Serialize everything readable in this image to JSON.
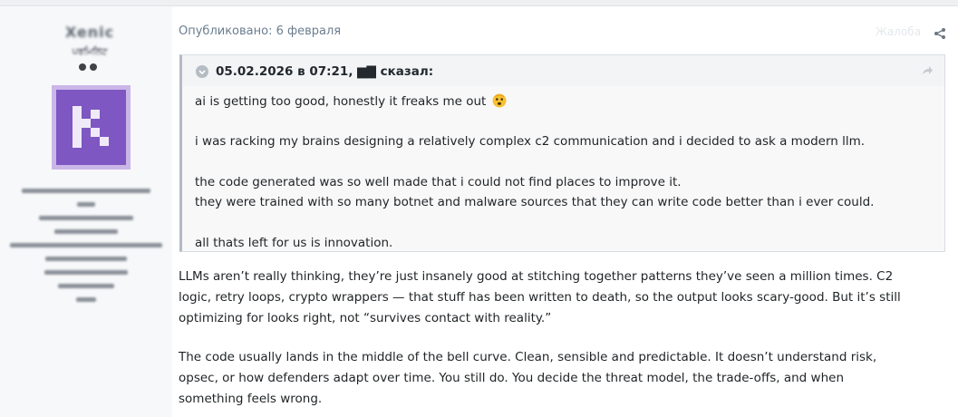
{
  "author": {
    "username": "Xenic",
    "title": "ਪਰਮਿਲਿਟ",
    "avatar_color": "#7e57c2"
  },
  "post": {
    "published": "Опубликовано: 6 февраля",
    "report_label": "Жалоба"
  },
  "quote": {
    "attribution": "05.02.2026 в 07:21, ▆▇ сказал:",
    "lines": [
      "ai is getting too good, honestly it freaks me out",
      "i was racking my brains designing a relatively complex c2 communication and i decided to ask a modern llm.",
      "the code generated was so well made that i could not find places to improve it.",
      "they were trained with so many botnet and malware sources that they can write code better than i ever could.",
      "all thats left for us is innovation."
    ],
    "emoji": "scared-face-emoji"
  },
  "reply": {
    "lines": [
      "LLMs aren’t really thinking, they’re just insanely good at stitching together patterns they’ve seen a million times. C2",
      "logic, retry loops, crypto wrappers — that stuff has been written to death, so the output looks scary-good. But it’s still",
      "optimizing for looks right, not “survives contact with reality.”",
      "The code usually lands in the middle of the bell curve. Clean, sensible and predictable. It doesn’t understand risk,",
      "opsec, or how defenders adapt over time. You still do. You decide the threat model, the trade-offs, and when",
      "something feels wrong."
    ]
  },
  "colors": {
    "link": "#6b7d8e",
    "text": "#1f2326",
    "quote_bg": "#f8f8f9",
    "quote_border": "#b2bbc3"
  }
}
